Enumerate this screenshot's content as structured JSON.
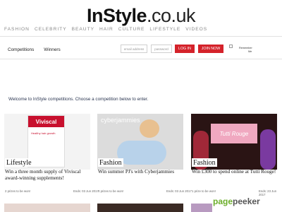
{
  "logo": {
    "brand": "InStyle",
    "domain": ".co.uk"
  },
  "nav": [
    "FASHION",
    "CELEBRITY",
    "BEAUTY",
    "HAIR",
    "CULTURE",
    "LIFESTYLE",
    "VIDEOS"
  ],
  "subnav": [
    "Competitions",
    "Winners"
  ],
  "login": {
    "email_placeholder": "email address",
    "password_placeholder": "password",
    "login_label": "LOG IN",
    "join_label": "JOIN NOW",
    "remember_label": "Remember",
    "remember_label2": "Me"
  },
  "welcome": "Welcome to InStyle competitions. Choose a competition below to enter.",
  "cards": [
    {
      "category": "Lifestyle",
      "title": "Win a three month supply of Viviscal award-winning supplements!",
      "prizes": "2 prizes to be won!",
      "ends": "Ends: 03 Jun 2017",
      "image_text": "Viviscal",
      "image_subtext": "Healthy hair growth"
    },
    {
      "category": "Fashion",
      "title": "Win summer PJ's with Cyberjammies",
      "prizes": "4 prizes to be won!",
      "ends": "Ends: 03 Jun 2017",
      "image_text": "cyberjammies"
    },
    {
      "category": "Fashion",
      "title": "Win £300 to spend online at Tutti Rouge!",
      "prizes": "1 prize to be won!",
      "ends": "Ends: 23 Jun 2017",
      "image_text": "Tutti Rouge"
    }
  ],
  "watermark": {
    "part1": "page",
    "part2": "peeker"
  },
  "colors": {
    "accent": "#d4222a",
    "watermark_green": "#6cae2b"
  }
}
